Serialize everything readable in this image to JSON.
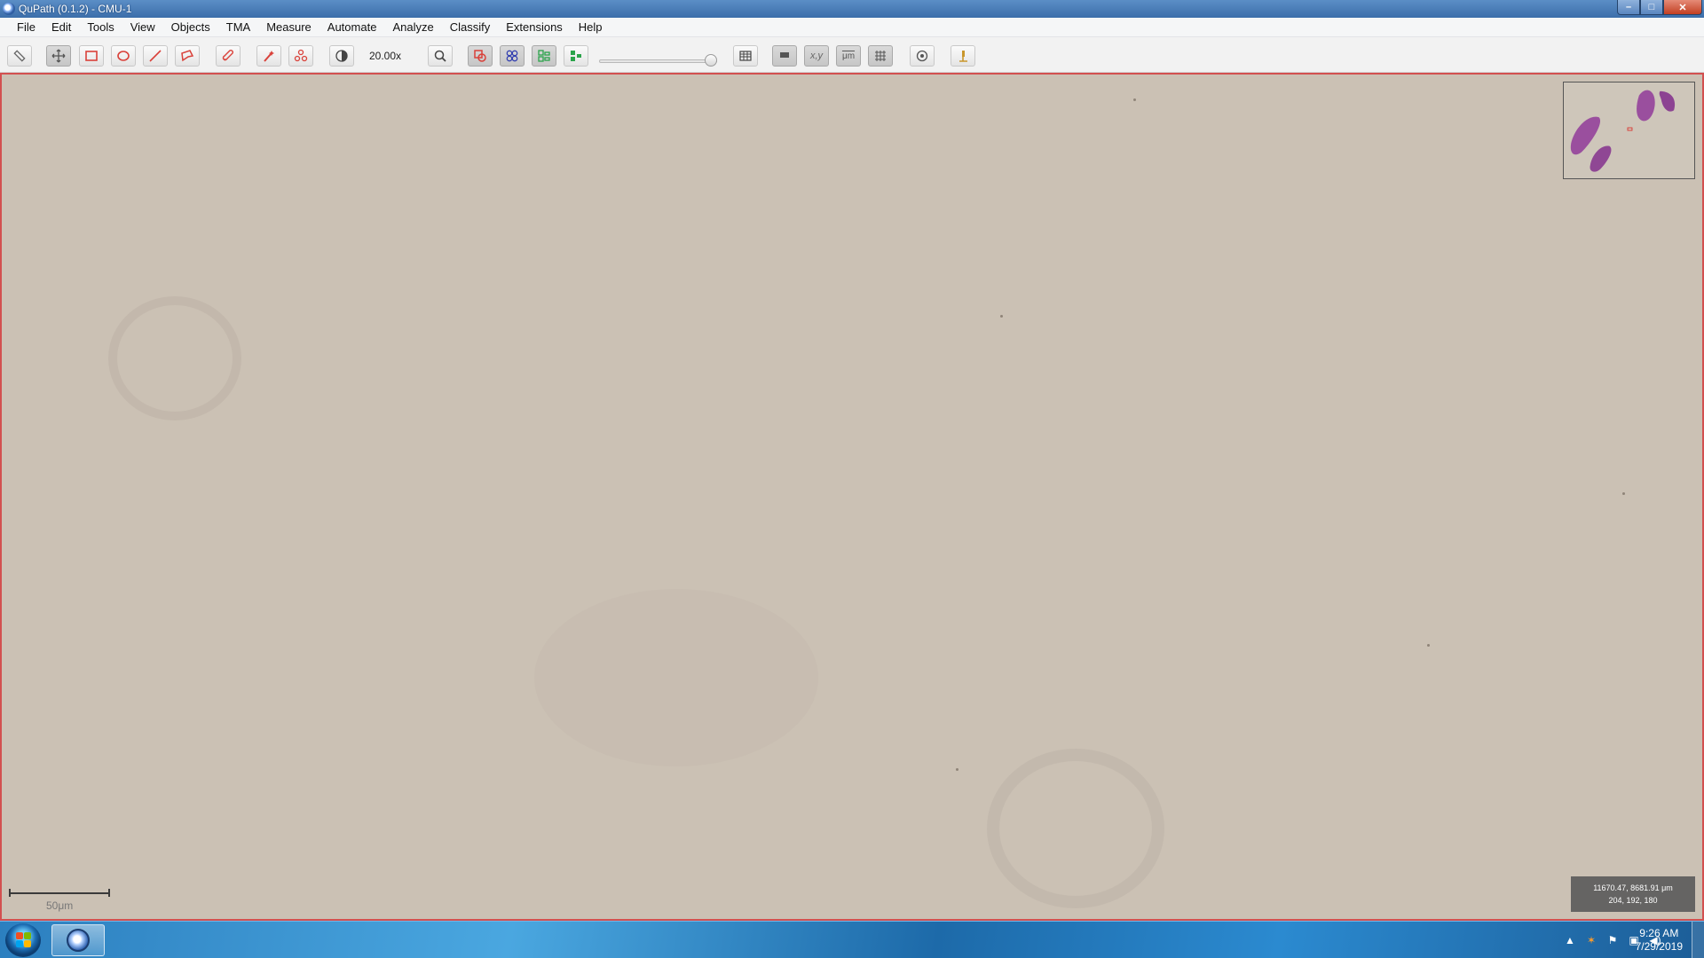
{
  "window": {
    "title": "QuPath (0.1.2) - CMU-1",
    "buttons": {
      "minimize": "–",
      "maximize": "□",
      "close": "✕"
    }
  },
  "menu": [
    "File",
    "Edit",
    "Tools",
    "View",
    "Objects",
    "TMA",
    "Measure",
    "Automate",
    "Analyze",
    "Classify",
    "Extensions",
    "Help"
  ],
  "toolbar": {
    "zoom_text": "20.00x",
    "xy_label": "x,y",
    "um_label": "μm",
    "opacity_slider_value": 1.0
  },
  "viewer": {
    "scale_label": "50μm",
    "cursor_position": "11670.47, 8681.91 μm",
    "pixel_value": "204, 192, 180",
    "background_color": "#cbc1b4",
    "roi_border_color": "#d35050"
  },
  "taskbar": {
    "time": "9:26 AM",
    "date": "7/29/2019"
  },
  "colors": {
    "tissue": "#9a4f9e",
    "accent": "#d9413a"
  }
}
